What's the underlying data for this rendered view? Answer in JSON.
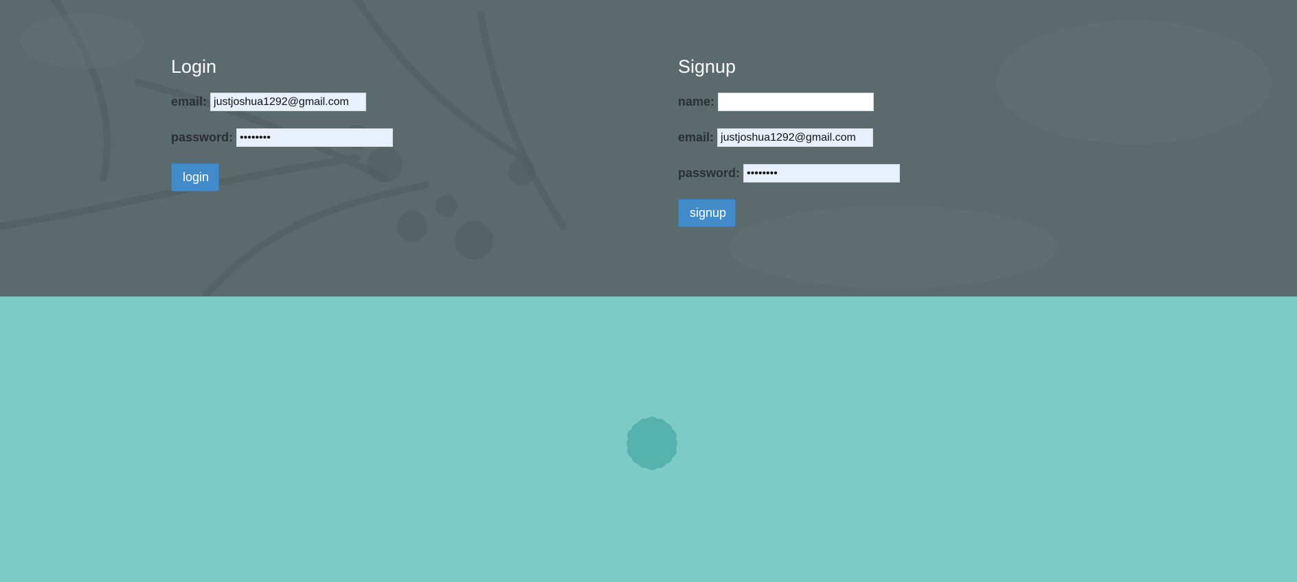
{
  "login": {
    "title": "Login",
    "email_label": "email:",
    "email_value": "justjoshua1292@gmail.com",
    "password_label": "password:",
    "password_value": "password",
    "button_label": "login"
  },
  "signup": {
    "title": "Signup",
    "name_label": "name:",
    "name_value": "",
    "email_label": "email:",
    "email_value": "justjoshua1292@gmail.com",
    "password_label": "password:",
    "password_value": "password",
    "button_label": "signup"
  },
  "colors": {
    "hero_background": "#5a6a6c",
    "lower_background": "#7ccbc7",
    "button": "#428bca",
    "spinner": "#56b2ae",
    "autofill_input": "#e8f0fe"
  },
  "icons": {
    "spinner": "loading-spinner-icon"
  }
}
